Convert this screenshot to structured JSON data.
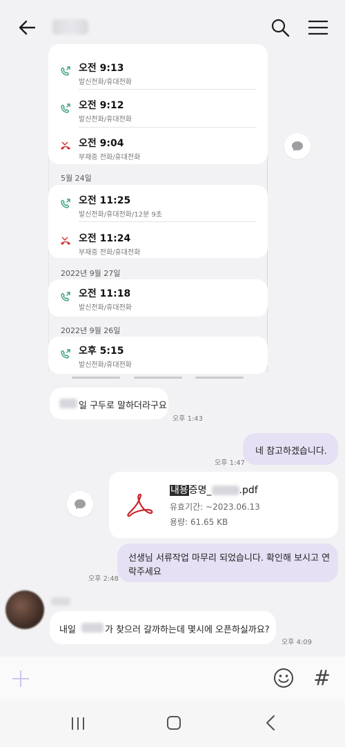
{
  "header": {
    "contact_name": ""
  },
  "call_log": {
    "groups": [
      {
        "date": "",
        "calls": [
          {
            "time": "오전 9:13",
            "detail": "발신전화/휴대전화",
            "kind": "outgoing"
          },
          {
            "time": "오전 9:12",
            "detail": "발신전화/휴대전화",
            "kind": "outgoing"
          },
          {
            "time": "오전 9:04",
            "detail": "부재중 전화/휴대전화",
            "kind": "missed"
          }
        ]
      },
      {
        "date": "5월 24일",
        "calls": [
          {
            "time": "오전 11:25",
            "detail": "발신전화/휴대전화/12분 9초",
            "kind": "outgoing"
          },
          {
            "time": "오전 11:24",
            "detail": "부재중 전화/휴대전화",
            "kind": "missed"
          }
        ]
      },
      {
        "date": "2022년 9월 27일",
        "calls": [
          {
            "time": "오전 11:18",
            "detail": "발신전화/휴대전화",
            "kind": "outgoing"
          }
        ]
      },
      {
        "date": "2022년 9월 26일",
        "calls": [
          {
            "time": "오후 5:15",
            "detail": "발신전화/휴대전화",
            "kind": "outgoing"
          }
        ]
      }
    ]
  },
  "messages": [
    {
      "direction": "in",
      "text": "일 구두로 말하더라구요",
      "time": "오후 1:43"
    },
    {
      "direction": "out",
      "text": "네 참고하겠습니다.",
      "time": "오후 1:47"
    },
    {
      "direction": "out",
      "type": "file",
      "file_name_highlight": "내용",
      "file_name_prefix": "증명_",
      "file_name_suffix": ".pdf",
      "expiry": "유효기간: ~2023.06.13",
      "size": "용량: 61.65 KB"
    },
    {
      "direction": "out",
      "text_line1": "선생님 서류작업 마무리 되었습니다. 확인해 보시고 연",
      "text_line2": "락주세요",
      "time": "오후 2:48"
    },
    {
      "direction": "in",
      "text_prefix": "내일",
      "text_suffix": "가 찾으러 갈까하는데 몇시에 오픈하실까요?",
      "time": "오후 4:09"
    }
  ],
  "colors": {
    "outgoing_bubble": "#e6e0f4",
    "incoming_bubble": "#ffffff",
    "call_outgoing_icon": "#3aa07a",
    "call_missed_icon": "#d0302a",
    "pdf_icon": "#c8252c"
  },
  "icons": [
    "back-arrow-icon",
    "search-icon",
    "menu-icon",
    "phone-outgoing-icon",
    "phone-missed-icon",
    "chat-bubble-icon",
    "pdf-icon",
    "plus-icon",
    "emoji-icon",
    "hashtag-icon",
    "nav-recent-icon",
    "nav-home-icon",
    "nav-back-icon"
  ],
  "input": {
    "hashtag": "#"
  }
}
